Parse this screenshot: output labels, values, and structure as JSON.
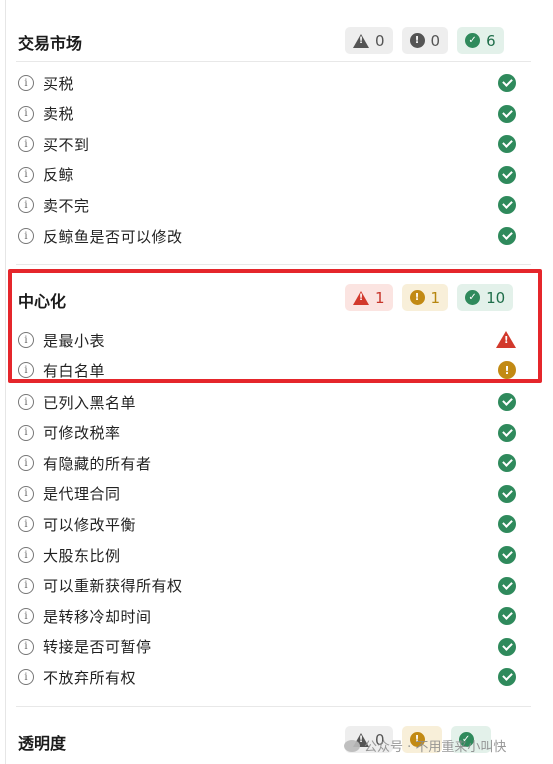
{
  "sections": {
    "trading": {
      "title": "交易市场",
      "badges": {
        "warning": "0",
        "caution": "0",
        "passed": "6"
      },
      "items": [
        "买税",
        "卖税",
        "买不到",
        "反鲸",
        "卖不完",
        "反鲸鱼是否可以修改"
      ]
    },
    "central": {
      "title": "中心化",
      "badges": {
        "warning": "1",
        "caution": "1",
        "passed": "10"
      },
      "flagged_items": [
        {
          "label": "是最小表",
          "status": "warning"
        },
        {
          "label": "有白名单",
          "status": "caution"
        }
      ],
      "items": [
        "已列入黑名单",
        "可修改税率",
        "有隐藏的所有者",
        "是代理合同",
        "可以修改平衡",
        "大股东比例",
        "可以重新获得所有权",
        "是转移冷却时间",
        "转接是否可暂停",
        "不放弃所有权"
      ]
    },
    "transparency": {
      "title": "透明度",
      "badges": {
        "warning": "0"
      }
    }
  },
  "info_glyph": "i",
  "icons": {
    "warning": "warning-triangle-icon",
    "caution": "caution-circle-icon",
    "passed": "check-circle-icon",
    "info": "info-icon"
  },
  "colors": {
    "highlight_border": "#e5262b",
    "ok": "#2f8a5c",
    "warning": "#d2392c",
    "caution": "#c28a14"
  },
  "watermark": "公众号 · 不用重来小叫快"
}
